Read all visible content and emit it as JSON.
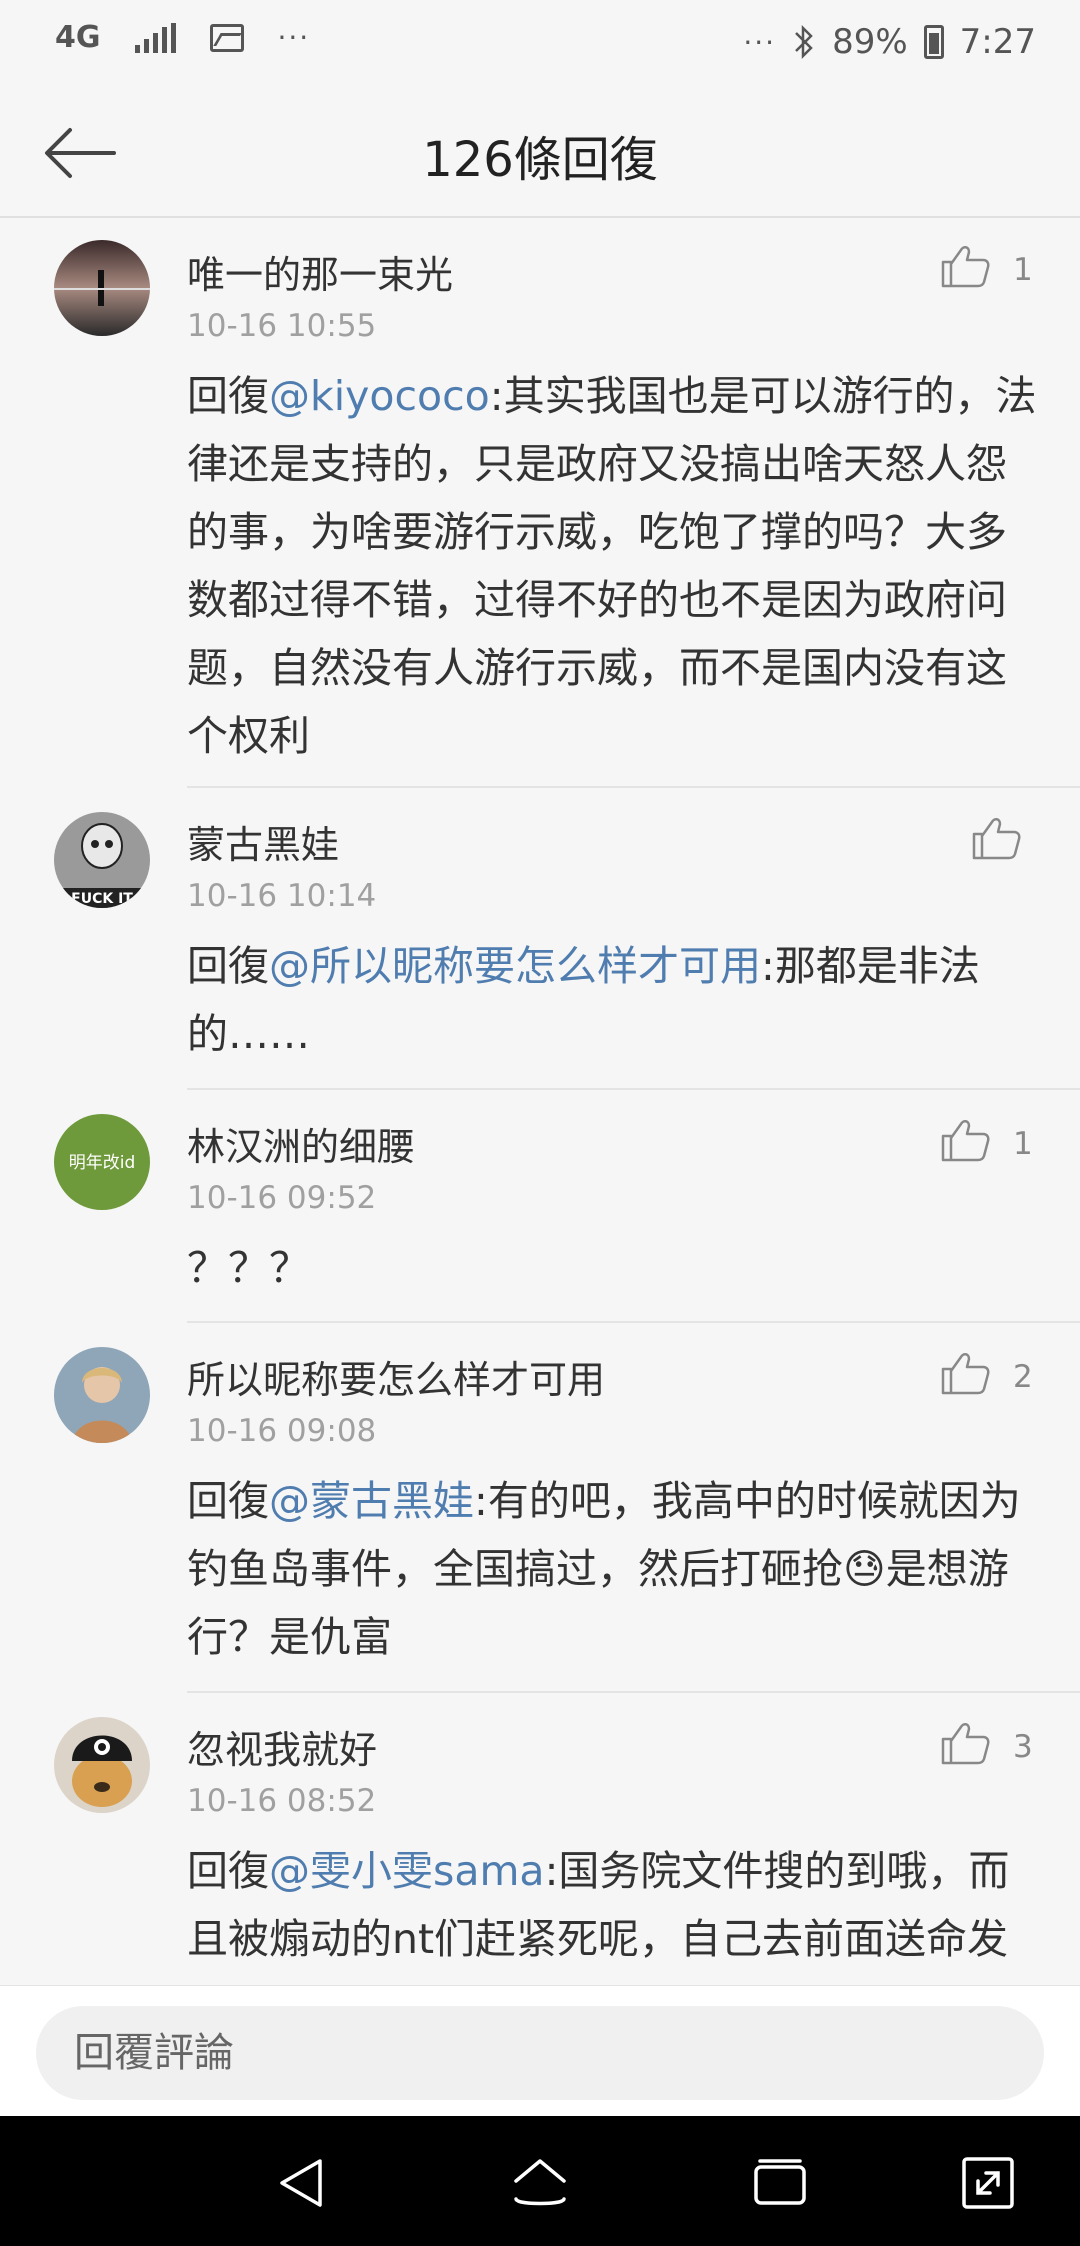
{
  "status_bar": {
    "network": "4G",
    "more_left": "···",
    "more_right": "···",
    "battery": "89%",
    "time": "7:27"
  },
  "header": {
    "title": "126條回復"
  },
  "comments": [
    {
      "user": "唯一的那一束光",
      "time": "10-16 10:55",
      "likes": "1",
      "reply_prefix": "回復",
      "mention": "@kiyococo",
      "text": ":其实我国也是可以游行的，法律还是支持的，只是政府又没搞出啥天怒人怨的事，为啥要游行示威，吃饱了撑的吗？大多数都过得不错，过得不好的也不是因为政府问题，自然没有人游行示威，而不是国内没有这个权利"
    },
    {
      "user": "蒙古黑娃",
      "time": "10-16 10:14",
      "likes": "",
      "reply_prefix": "回復",
      "mention": "@所以昵称要怎么样才可用",
      "text": ":那都是非法的……",
      "avatar_text": "FUCK IT"
    },
    {
      "user": "林汉洲的细腰",
      "time": "10-16 09:52",
      "likes": "1",
      "reply_prefix": "",
      "mention": "",
      "text": "？？？",
      "avatar_text": "明年改id"
    },
    {
      "user": "所以昵称要怎么样才可用",
      "time": "10-16 09:08",
      "likes": "2",
      "reply_prefix": "回復",
      "mention": "@蒙古黑娃",
      "text": ":有的吧，我高中的时候就因为钓鱼岛事件，全国搞过，然后打砸抢😓是想游行？是仇富"
    },
    {
      "user": "忽视我就好",
      "time": "10-16 08:52",
      "likes": "3",
      "reply_prefix": "回復",
      "mention": "@雯小雯sama",
      "text": ":国务院文件搜的到哦，而且被煽动的nt们赶紧死呢，自己去前面送命发"
    }
  ],
  "reply_bar": {
    "placeholder": "回覆評論"
  },
  "icons": {
    "back": "back-arrow-icon",
    "like": "thumbs-up-icon",
    "nav_back": "triangle-back-icon",
    "nav_home": "home-icon",
    "nav_recents": "recents-icon",
    "nav_expand": "expand-icon"
  }
}
